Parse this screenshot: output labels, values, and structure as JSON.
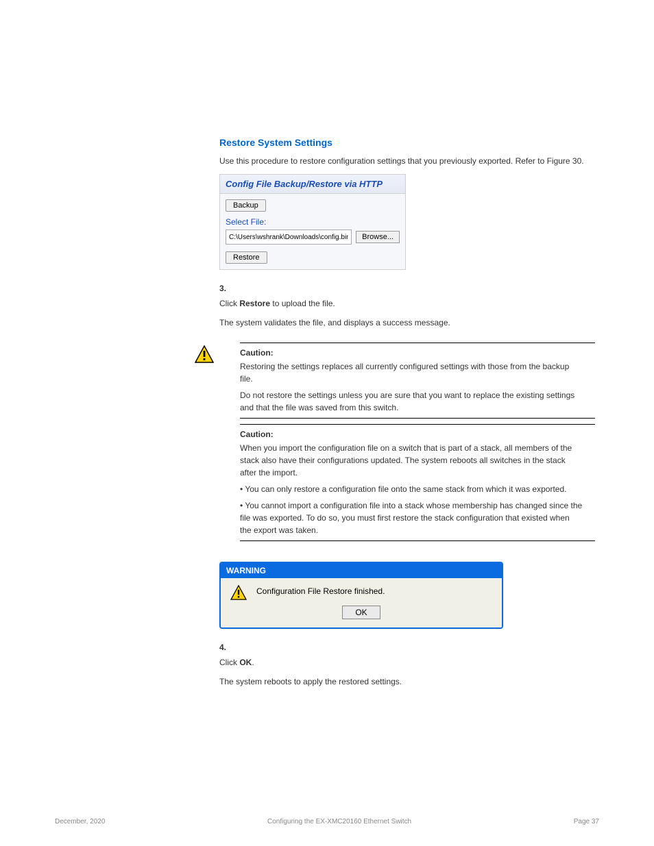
{
  "section": {
    "heading": "Restore System Settings",
    "intro": "Use this procedure to restore configuration settings that you previously exported. Refer to Figure 30.",
    "step3_num": "3.",
    "step3_text_a": "Click ",
    "step3_bold": "Restore",
    "step3_text_b": " to upload the file.",
    "step3_result": "The system validates the file, and displays a success message."
  },
  "http_panel": {
    "title": "Config File Backup/Restore via HTTP",
    "backup_label": "Backup",
    "select_file_label": "Select File:",
    "file_value": "C:\\Users\\wshrank\\Downloads\\config.bin",
    "browse_label": "Browse...",
    "restore_label": "Restore"
  },
  "caution1": {
    "title": "Caution:",
    "line1": "Restoring the settings replaces all currently configured settings with those from the backup file.",
    "line2": "Do not restore the settings unless you are sure that you want to replace the existing settings and that the file was saved from this switch."
  },
  "caution2": {
    "title": "Caution:",
    "body": "When you import the configuration file on a switch that is part of a stack, all members of the stack also have their configurations updated. The system reboots all switches in the stack after the import.",
    "bullet1_label": "•",
    "bullet1_text": "You can only restore a configuration file onto the same stack from which it was exported.",
    "bullet2_label": "•",
    "bullet2_text": "You cannot import a configuration file into a stack whose membership has changed since the file was exported. To do so, you must first restore the stack configuration that existed when the export was taken."
  },
  "warning_dialog": {
    "titlebar": "WARNING",
    "message": "Configuration File Restore finished.",
    "ok_label": "OK"
  },
  "after_dialog": {
    "step4_num": "4.",
    "step4_text_a": "Click ",
    "step4_bold": "OK",
    "step4_text_b": ".",
    "step4_result": "The system reboots to apply the restored settings."
  },
  "footer": {
    "left": "December, 2020",
    "center": "Configuring the EX-XMC20160 Ethernet Switch",
    "right": "Page 37"
  }
}
